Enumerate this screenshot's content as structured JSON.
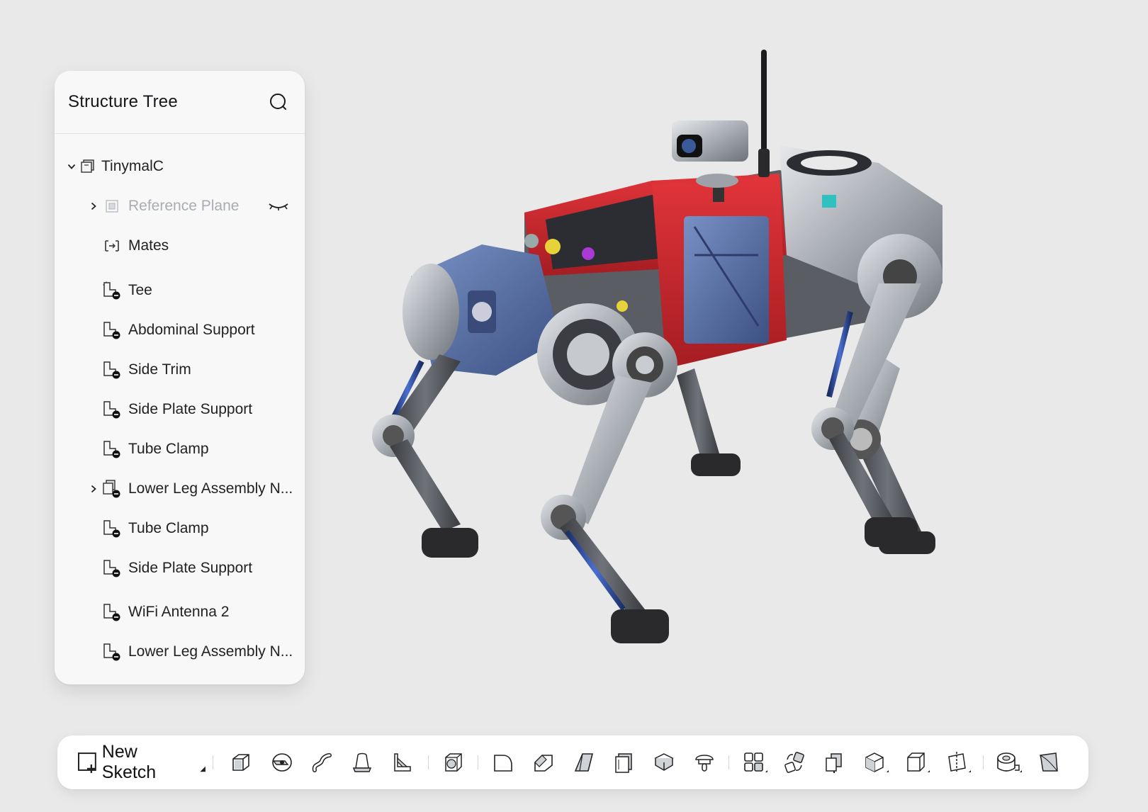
{
  "tree": {
    "title": "Structure Tree",
    "items": [
      {
        "label": "TinymalC",
        "icon": "assembly-icon",
        "expandable": true,
        "expanded": true,
        "level": 0
      },
      {
        "label": "Reference Plane",
        "icon": "plane-icon",
        "expandable": true,
        "expanded": false,
        "level": 1,
        "hidden": true
      },
      {
        "label": "Mates",
        "icon": "mates-icon",
        "expandable": false,
        "level": 1
      },
      {
        "label": "Tee",
        "icon": "part-icon",
        "expandable": false,
        "level": 1
      },
      {
        "label": "Abdominal Support",
        "icon": "part-icon",
        "expandable": false,
        "level": 1
      },
      {
        "label": "Side Trim",
        "icon": "part-icon",
        "expandable": false,
        "level": 1
      },
      {
        "label": "Side Plate Support",
        "icon": "part-icon",
        "expandable": false,
        "level": 1
      },
      {
        "label": "Tube Clamp",
        "icon": "part-icon",
        "expandable": false,
        "level": 1
      },
      {
        "label": "Lower Leg Assembly N...",
        "icon": "subassembly-icon",
        "expandable": true,
        "expanded": false,
        "level": 1
      },
      {
        "label": "Tube Clamp",
        "icon": "part-icon",
        "expandable": false,
        "level": 1
      },
      {
        "label": "Side Plate Support",
        "icon": "part-icon",
        "expandable": false,
        "level": 1
      },
      {
        "label": "WiFi Antenna 2",
        "icon": "part-icon",
        "expandable": false,
        "level": 1
      },
      {
        "label": "Lower Leg Assembly N...",
        "icon": "part-icon",
        "expandable": false,
        "level": 1
      }
    ]
  },
  "toolbar": {
    "new_sketch_label": "New Sketch",
    "tools": [
      "extrude-icon",
      "revolve-icon",
      "sweep-icon",
      "loft-icon",
      "rib-icon",
      "shell-icon",
      "fillet-icon",
      "chamfer-icon",
      "draft-icon",
      "thicken-icon",
      "split-icon",
      "hole-icon",
      "pattern-icon",
      "mirror-icon",
      "move-body-icon",
      "combine-icon",
      "box-primitive-icon",
      "section-plane-icon",
      "measure-icon",
      "surface-icon"
    ]
  },
  "colors": {
    "background": "#e9e9ea",
    "panel": "#f8f8f9",
    "robot_frame_red": "#c8262c",
    "robot_blue": "#51689a",
    "robot_silver": "#b8bcc2"
  }
}
